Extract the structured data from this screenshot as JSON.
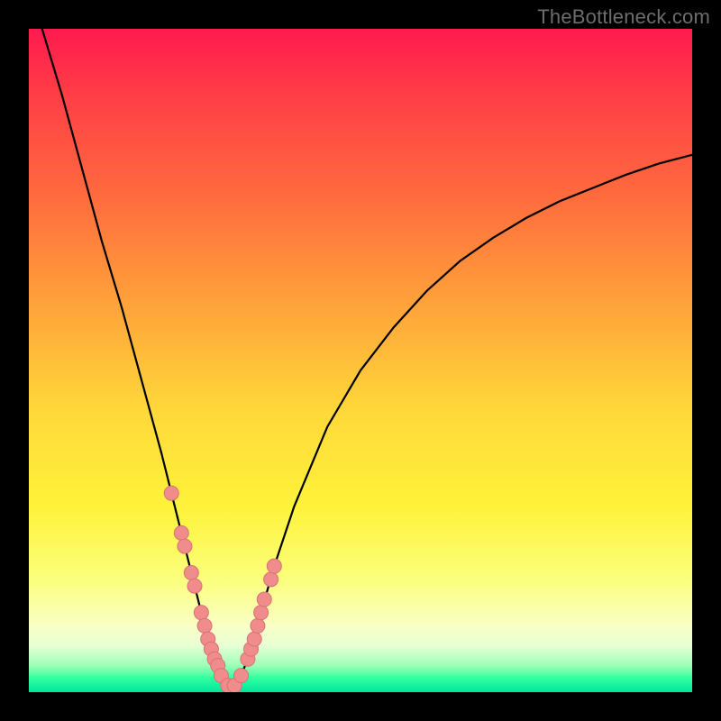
{
  "watermark": "TheBottleneck.com",
  "chart_data": {
    "type": "line",
    "title": "",
    "xlabel": "",
    "ylabel": "",
    "xlim": [
      0,
      100
    ],
    "ylim": [
      0,
      100
    ],
    "x": [
      2,
      5,
      8,
      11,
      14,
      17,
      20,
      21.5,
      23,
      24.5,
      26,
      27,
      28,
      29,
      30,
      31,
      32,
      33,
      34,
      35,
      37,
      40,
      45,
      50,
      55,
      60,
      65,
      70,
      75,
      80,
      85,
      90,
      95,
      100
    ],
    "values": [
      100,
      90,
      79,
      68,
      58,
      47,
      36,
      30,
      24,
      18,
      12,
      8,
      5,
      2.5,
      1,
      1,
      2.5,
      5,
      8,
      12,
      19,
      28,
      40,
      48.5,
      55,
      60.5,
      65,
      68.5,
      71.5,
      74,
      76,
      78,
      79.7,
      81
    ],
    "series_markers": {
      "note": "highlighted scatter points along curve near minimum",
      "x": [
        21.5,
        23,
        23.5,
        24.5,
        25,
        26,
        26.5,
        27,
        27.5,
        28,
        28.5,
        29,
        30,
        31,
        32,
        33,
        33.5,
        34,
        34.5,
        35,
        35.5,
        36.5,
        37
      ],
      "y": [
        30,
        24,
        22,
        18,
        16,
        12,
        10,
        8,
        6.5,
        5,
        4,
        2.5,
        1,
        1,
        2.5,
        5,
        6.5,
        8,
        10,
        12,
        14,
        17,
        19
      ]
    },
    "colors": {
      "curve": "#000000",
      "marker_fill": "#f08c8c",
      "marker_stroke": "#d87272",
      "background_top": "#ff1a4f",
      "background_bottom": "#00e59b"
    }
  }
}
